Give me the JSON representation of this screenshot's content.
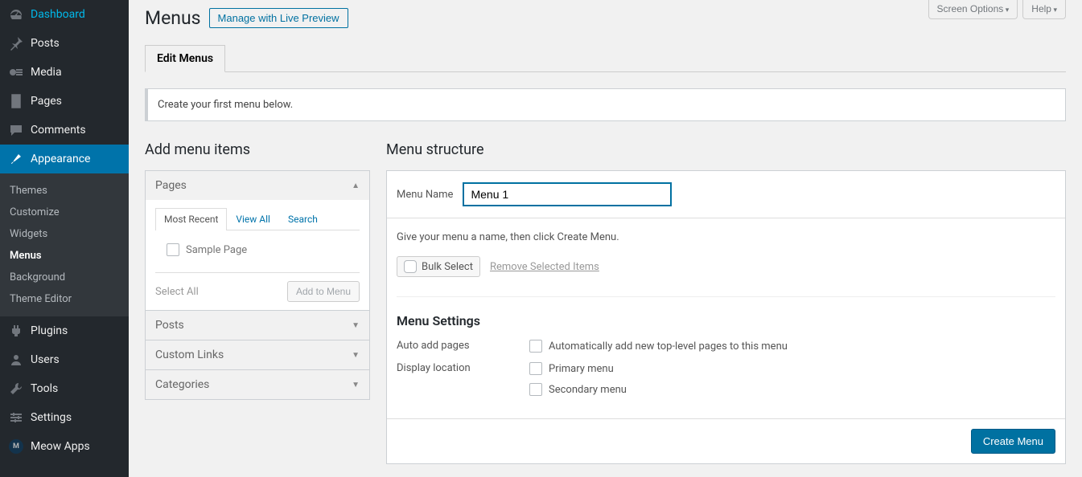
{
  "screen_options": {
    "screen": "Screen Options",
    "help": "Help"
  },
  "header": {
    "title": "Menus",
    "preview_btn": "Manage with Live Preview"
  },
  "tabs": {
    "edit": "Edit Menus"
  },
  "notice": "Create your first menu below.",
  "sidebar": {
    "dashboard": "Dashboard",
    "posts": "Posts",
    "media": "Media",
    "pages": "Pages",
    "comments": "Comments",
    "appearance": "Appearance",
    "sub": {
      "themes": "Themes",
      "customize": "Customize",
      "widgets": "Widgets",
      "menus": "Menus",
      "background": "Background",
      "theme_editor": "Theme Editor"
    },
    "plugins": "Plugins",
    "users": "Users",
    "tools": "Tools",
    "settings": "Settings",
    "meow": "Meow Apps"
  },
  "left_col": {
    "heading": "Add menu items",
    "boxes": {
      "pages": {
        "title": "Pages",
        "tabs": {
          "recent": "Most Recent",
          "view_all": "View All",
          "search": "Search"
        },
        "items": [
          "Sample Page"
        ],
        "select_all": "Select All",
        "add_btn": "Add to Menu"
      },
      "posts": "Posts",
      "custom_links": "Custom Links",
      "categories": "Categories"
    }
  },
  "right_col": {
    "heading": "Menu structure",
    "name_label": "Menu Name",
    "name_value": "Menu 1",
    "instruction": "Give your menu a name, then click Create Menu.",
    "bulk_select": "Bulk Select",
    "remove_selected": "Remove Selected Items",
    "settings_heading": "Menu Settings",
    "auto_add": {
      "label": "Auto add pages",
      "option": "Automatically add new top-level pages to this menu"
    },
    "display_loc": {
      "label": "Display location",
      "primary": "Primary menu",
      "secondary": "Secondary menu"
    },
    "create_btn": "Create Menu"
  }
}
